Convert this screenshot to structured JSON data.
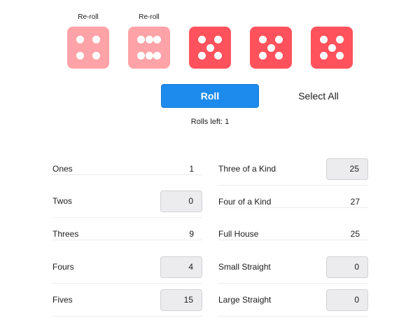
{
  "dice": [
    {
      "value": 4,
      "held": true,
      "reroll_label": "Re-roll"
    },
    {
      "value": 6,
      "held": true,
      "reroll_label": "Re-roll"
    },
    {
      "value": 5,
      "held": false,
      "reroll_label": ""
    },
    {
      "value": 5,
      "held": false,
      "reroll_label": ""
    },
    {
      "value": 5,
      "held": false,
      "reroll_label": ""
    }
  ],
  "controls": {
    "roll_label": "Roll",
    "select_all_label": "Select All",
    "rolls_left_text": "Rolls left: 1"
  },
  "colors": {
    "die_held": "#ffa3a8",
    "die_active": "#ff525c",
    "roll_button": "#1c8bed"
  },
  "upper_section": [
    {
      "label": "Ones",
      "score": "1",
      "selectable": false
    },
    {
      "label": "Twos",
      "score": "0",
      "selectable": true
    },
    {
      "label": "Threes",
      "score": "9",
      "selectable": false
    },
    {
      "label": "Fours",
      "score": "4",
      "selectable": true
    },
    {
      "label": "Fives",
      "score": "15",
      "selectable": true
    }
  ],
  "lower_section": [
    {
      "label": "Three of a Kind",
      "score": "25",
      "selectable": true
    },
    {
      "label": "Four of a Kind",
      "score": "27",
      "selectable": false
    },
    {
      "label": "Full House",
      "score": "25",
      "selectable": false
    },
    {
      "label": "Small Straight",
      "score": "0",
      "selectable": true
    },
    {
      "label": "Large Straight",
      "score": "0",
      "selectable": true
    }
  ]
}
